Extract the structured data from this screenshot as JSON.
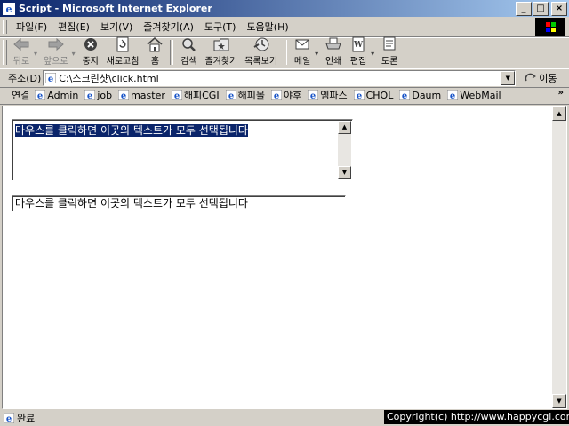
{
  "window": {
    "title": "Script - Microsoft Internet Explorer",
    "buttons": {
      "minimize": "_",
      "maximize": "□",
      "close": "×"
    }
  },
  "menu": [
    "파일(F)",
    "편집(E)",
    "보기(V)",
    "즐겨찾기(A)",
    "도구(T)",
    "도움말(H)"
  ],
  "toolbar": {
    "back": "뒤로",
    "forward": "앞으로",
    "stop": "중지",
    "refresh": "새로고침",
    "home": "홈",
    "search": "검색",
    "favorites": "즐겨찾기",
    "history": "목록보기",
    "mail": "메일",
    "print": "인쇄",
    "edit": "편집",
    "discuss": "토론"
  },
  "address": {
    "label": "주소(D)",
    "url": "C:\\스크린샷\\click.html",
    "go": "이동"
  },
  "links": {
    "label": "연결",
    "items": [
      "Admin",
      "job",
      "master",
      "해피CGI",
      "해피몰",
      "야후",
      "엠파스",
      "CHOL",
      "Daum",
      "WebMail"
    ],
    "more": "»"
  },
  "page": {
    "textarea_text": "마우스를 클릭하면 이곳의 텍스트가 모두 선택됩니다",
    "input_value": "마우스를 클릭하면 이곳의 텍스트가 모두 선택됩니다"
  },
  "status": {
    "text": "완료",
    "overlay": "Copyright(c) http://www.happycgi.com"
  },
  "colors": {
    "titlebar_start": "#0a246a",
    "titlebar_end": "#a6caf0",
    "selection": "#0a246a",
    "chrome": "#d4d0c8"
  }
}
